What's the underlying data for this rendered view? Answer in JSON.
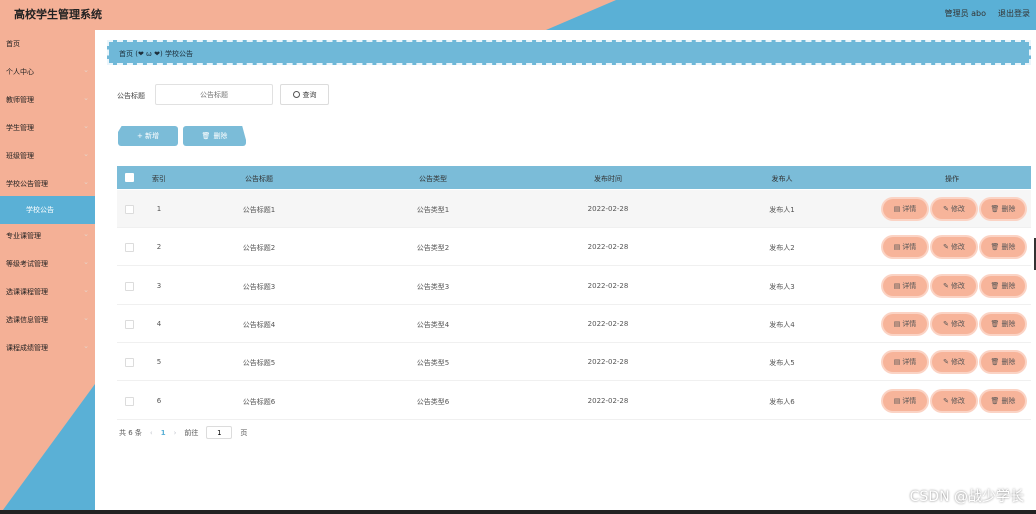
{
  "header": {
    "title": "高校学生管理系统",
    "user": "管理员 abo",
    "logout": "退出登录"
  },
  "sidebar": {
    "items": [
      {
        "label": "首页",
        "arrow": ""
      },
      {
        "label": "个人中心",
        "arrow": "⌄"
      },
      {
        "label": "教师管理",
        "arrow": "⌄"
      },
      {
        "label": "学生管理",
        "arrow": "⌄"
      },
      {
        "label": "班级管理",
        "arrow": "⌄"
      },
      {
        "label": "学校公告管理",
        "arrow": "⌄"
      },
      {
        "label": "学校公告",
        "arrow": ""
      },
      {
        "label": "专业课管理",
        "arrow": "⌄"
      },
      {
        "label": "等级考试管理",
        "arrow": "⌄"
      },
      {
        "label": "选课课程管理",
        "arrow": "⌄"
      },
      {
        "label": "选课信息管理",
        "arrow": "⌄"
      },
      {
        "label": "课程成绩管理",
        "arrow": "⌄"
      }
    ]
  },
  "breadcrumb": {
    "text": "首页 (❤ ω ❤) 学校公告"
  },
  "search": {
    "label": "公告标题",
    "placeholder": "公告标题",
    "button": "查询"
  },
  "actions": {
    "add": "+ 新增",
    "delete": "删除"
  },
  "table": {
    "headers": [
      "索引",
      "公告标题",
      "公告类型",
      "发布时间",
      "发布人",
      "操作"
    ],
    "rows": [
      {
        "index": "1",
        "title": "公告标题1",
        "type": "公告类型1",
        "time": "2022-02-28",
        "publisher": "发布人1"
      },
      {
        "index": "2",
        "title": "公告标题2",
        "type": "公告类型2",
        "time": "2022-02-28",
        "publisher": "发布人2"
      },
      {
        "index": "3",
        "title": "公告标题3",
        "type": "公告类型3",
        "time": "2022-02-28",
        "publisher": "发布人3"
      },
      {
        "index": "4",
        "title": "公告标题4",
        "type": "公告类型4",
        "time": "2022-02-28",
        "publisher": "发布人4"
      },
      {
        "index": "5",
        "title": "公告标题5",
        "type": "公告类型5",
        "time": "2022-02-28",
        "publisher": "发布人5"
      },
      {
        "index": "6",
        "title": "公告标题6",
        "type": "公告类型6",
        "time": "2022-02-28",
        "publisher": "发布人6"
      }
    ],
    "row_actions": {
      "detail": "详情",
      "edit": "修改",
      "delete": "删除"
    }
  },
  "pagination": {
    "total": "共 6 条",
    "prev": "‹",
    "current": "1",
    "next": "›",
    "goto_prefix": "前往",
    "goto_value": "1",
    "goto_suffix": "页"
  },
  "watermark": "CSDN @战少学长",
  "colors": {
    "peach": "#f4b096",
    "blue": "#5ab0d6",
    "header_blue": "#7bbcd8"
  }
}
